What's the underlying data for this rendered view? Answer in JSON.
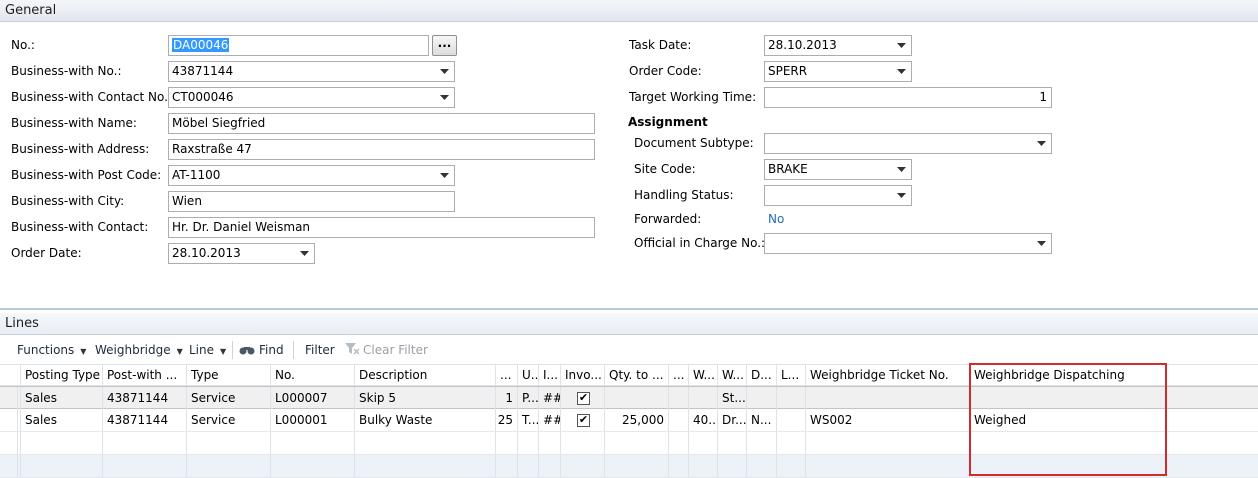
{
  "general": {
    "title": "General",
    "left": [
      {
        "label": "No.:",
        "value": "DA00046"
      },
      {
        "label": "Business-with No.:",
        "value": "43871144"
      },
      {
        "label": "Business-with Contact No.:",
        "value": "CT000046"
      },
      {
        "label": "Business-with Name:",
        "value": "Möbel Siegfried"
      },
      {
        "label": "Business-with Address:",
        "value": "Raxstraße 47"
      },
      {
        "label": "Business-with Post Code:",
        "value": "AT-1100"
      },
      {
        "label": "Business-with City:",
        "value": "Wien"
      },
      {
        "label": "Business-with Contact:",
        "value": "Hr. Dr. Daniel Weisman"
      },
      {
        "label": "Order Date:",
        "value": "28.10.2013"
      }
    ],
    "assist_label": "...",
    "right": [
      {
        "label": "Task Date:",
        "value": "28.10.2013"
      },
      {
        "label": "Order Code:",
        "value": "SPERR"
      },
      {
        "label": "Target Working Time:",
        "value": "1"
      }
    ],
    "assignment": {
      "heading": "Assignment",
      "fields": [
        {
          "label": "Document Subtype:",
          "value": ""
        },
        {
          "label": "Site Code:",
          "value": "BRAKE"
        },
        {
          "label": "Handling Status:",
          "value": ""
        },
        {
          "label": "Forwarded:",
          "value": "No"
        },
        {
          "label": "Official in Charge No.:",
          "value": ""
        }
      ]
    }
  },
  "lines": {
    "title": "Lines",
    "toolbar": {
      "functions": "Functions",
      "weighbridge": "Weighbridge",
      "line": "Line",
      "find": "Find",
      "filter": "Filter",
      "clear_filter": "Clear Filter"
    },
    "columns": [
      "Posting Type",
      "Post-with ...",
      "Type",
      "No.",
      "Description",
      "...",
      "U...",
      "I...",
      "Invo...",
      "Qty. to ...",
      "...",
      "W...",
      "W...",
      "D...",
      "L...",
      "Weighbridge Ticket No.",
      "Weighbridge Dispatching"
    ],
    "rows": [
      {
        "posting_type": "Sales",
        "post_with": "43871144",
        "type": "Service",
        "no": "L000007",
        "description": "Skip 5",
        "c5": "1",
        "c6": "P...",
        "c7": "##",
        "invoice": true,
        "qty": "",
        "c10": "",
        "c11": "",
        "c12": "St...",
        "c13": "",
        "c14": "",
        "ticket": "",
        "dispatching": ""
      },
      {
        "posting_type": "Sales",
        "post_with": "43871144",
        "type": "Service",
        "no": "L000001",
        "description": "Bulky Waste",
        "c5": "25",
        "c6": "T...",
        "c7": "##",
        "invoice": true,
        "qty": "25,000",
        "c10": "",
        "c11": "40...",
        "c12": "Dr...",
        "c13": "N...",
        "c14": "",
        "ticket": "WS002",
        "dispatching": "Weighed"
      }
    ]
  },
  "colors": {
    "section_bg": "#e2e7ee",
    "link": "#2a6ab2",
    "highlight": "#d22b2b",
    "selection": "#3399ff"
  }
}
